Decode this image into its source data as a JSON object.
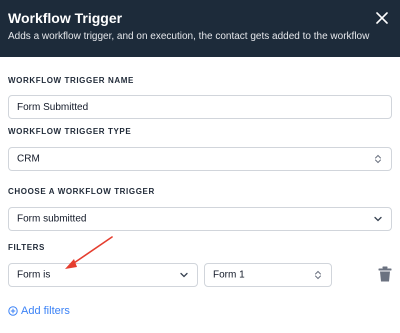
{
  "header": {
    "title": "Workflow Trigger",
    "subtitle": "Adds a workflow trigger, and on execution, the contact gets added to the workflow",
    "close_icon": "close-icon"
  },
  "trigger_name": {
    "label": "WORKFLOW TRIGGER NAME",
    "value": "Form Submitted"
  },
  "trigger_type": {
    "label": "WORKFLOW TRIGGER TYPE",
    "value": "CRM"
  },
  "choose_trigger": {
    "label": "CHOOSE A WORKFLOW TRIGGER",
    "value": "Form submitted"
  },
  "filters": {
    "label": "FILTERS",
    "condition": "Form is",
    "form_value": "Form 1",
    "delete_icon": "trash-icon",
    "add_label": "Add filters",
    "add_icon": "plus-circle-icon"
  },
  "colors": {
    "header_bg": "#1d2b3a",
    "accent": "#3b82f6",
    "annotation_arrow": "#e53e2f"
  }
}
